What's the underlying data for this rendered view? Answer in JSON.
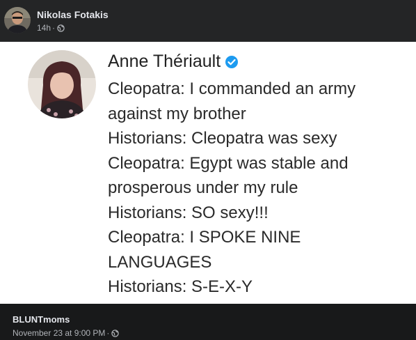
{
  "post": {
    "author": "Nikolas Fotakis",
    "time": "14h",
    "separator": "·",
    "privacy_icon": "globe-icon"
  },
  "tweet_image": {
    "account_name": "Anne Thériault",
    "verified_icon": "verified-badge-icon",
    "lines": [
      "Cleopatra: I commanded an army",
      "against my brother",
      "Historians: Cleopatra was sexy",
      "Cleopatra: Egypt was stable and",
      "prosperous under my rule",
      "Historians: SO sexy!!!",
      "Cleopatra: I SPOKE NINE",
      "LANGUAGES",
      "Historians: S-E-X-Y"
    ]
  },
  "shared_from": {
    "page": "BLUNTmoms",
    "date": "November 23 at 9:00 PM",
    "separator": "·",
    "privacy_icon": "globe-icon"
  },
  "colors": {
    "header_bg": "#242526",
    "page_bg": "#18191a",
    "name_text": "#e4e6eb",
    "meta_text": "#b0b3b8",
    "verified_blue": "#1d9bf0"
  }
}
